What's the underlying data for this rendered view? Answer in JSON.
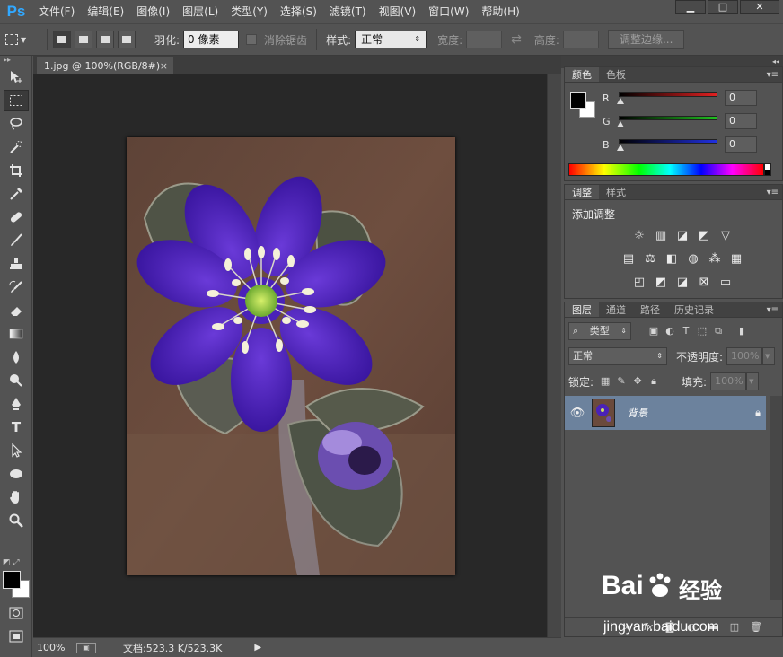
{
  "app": {
    "logo": "Ps",
    "menu": [
      "文件(F)",
      "编辑(E)",
      "图像(I)",
      "图层(L)",
      "类型(Y)",
      "选择(S)",
      "滤镜(T)",
      "视图(V)",
      "窗口(W)",
      "帮助(H)"
    ],
    "window_buttons": [
      "▁",
      "□",
      "✕"
    ]
  },
  "options": {
    "feather_label": "羽化:",
    "feather_value": "0 像素",
    "antialias_label": "消除锯齿",
    "style_label": "样式:",
    "style_value": "正常",
    "width_label": "宽度:",
    "height_label": "高度:",
    "refine_button": "调整边缘..."
  },
  "document": {
    "tab_title": "1.jpg @ 100%(RGB/8#)",
    "tab_close": "×",
    "status_zoom": "100%",
    "status_doc": "文档:523.3 K/523.3K"
  },
  "color_panel": {
    "tabs": [
      "颜色",
      "色板"
    ],
    "channels": [
      {
        "label": "R",
        "value": "0",
        "color": "#e02020"
      },
      {
        "label": "G",
        "value": "0",
        "color": "#20c020"
      },
      {
        "label": "B",
        "value": "0",
        "color": "#2030e0"
      }
    ]
  },
  "adjustments_panel": {
    "tabs": [
      "调整",
      "样式"
    ],
    "title": "添加调整"
  },
  "layers_panel": {
    "tabs": [
      "图层",
      "通道",
      "路径",
      "历史记录"
    ],
    "filter_kind": "类型",
    "blend_mode": "正常",
    "opacity_label": "不透明度:",
    "opacity_value": "100%",
    "lock_label": "锁定:",
    "fill_label": "填充:",
    "fill_value": "100%",
    "layer_name": "背景"
  },
  "watermark": {
    "brand": "Bai",
    "brand2": "经验",
    "url": "jingyan.baidu.com"
  },
  "colors": {
    "selected_layer": "#6c829d",
    "ps_blue": "#31a8ff"
  }
}
